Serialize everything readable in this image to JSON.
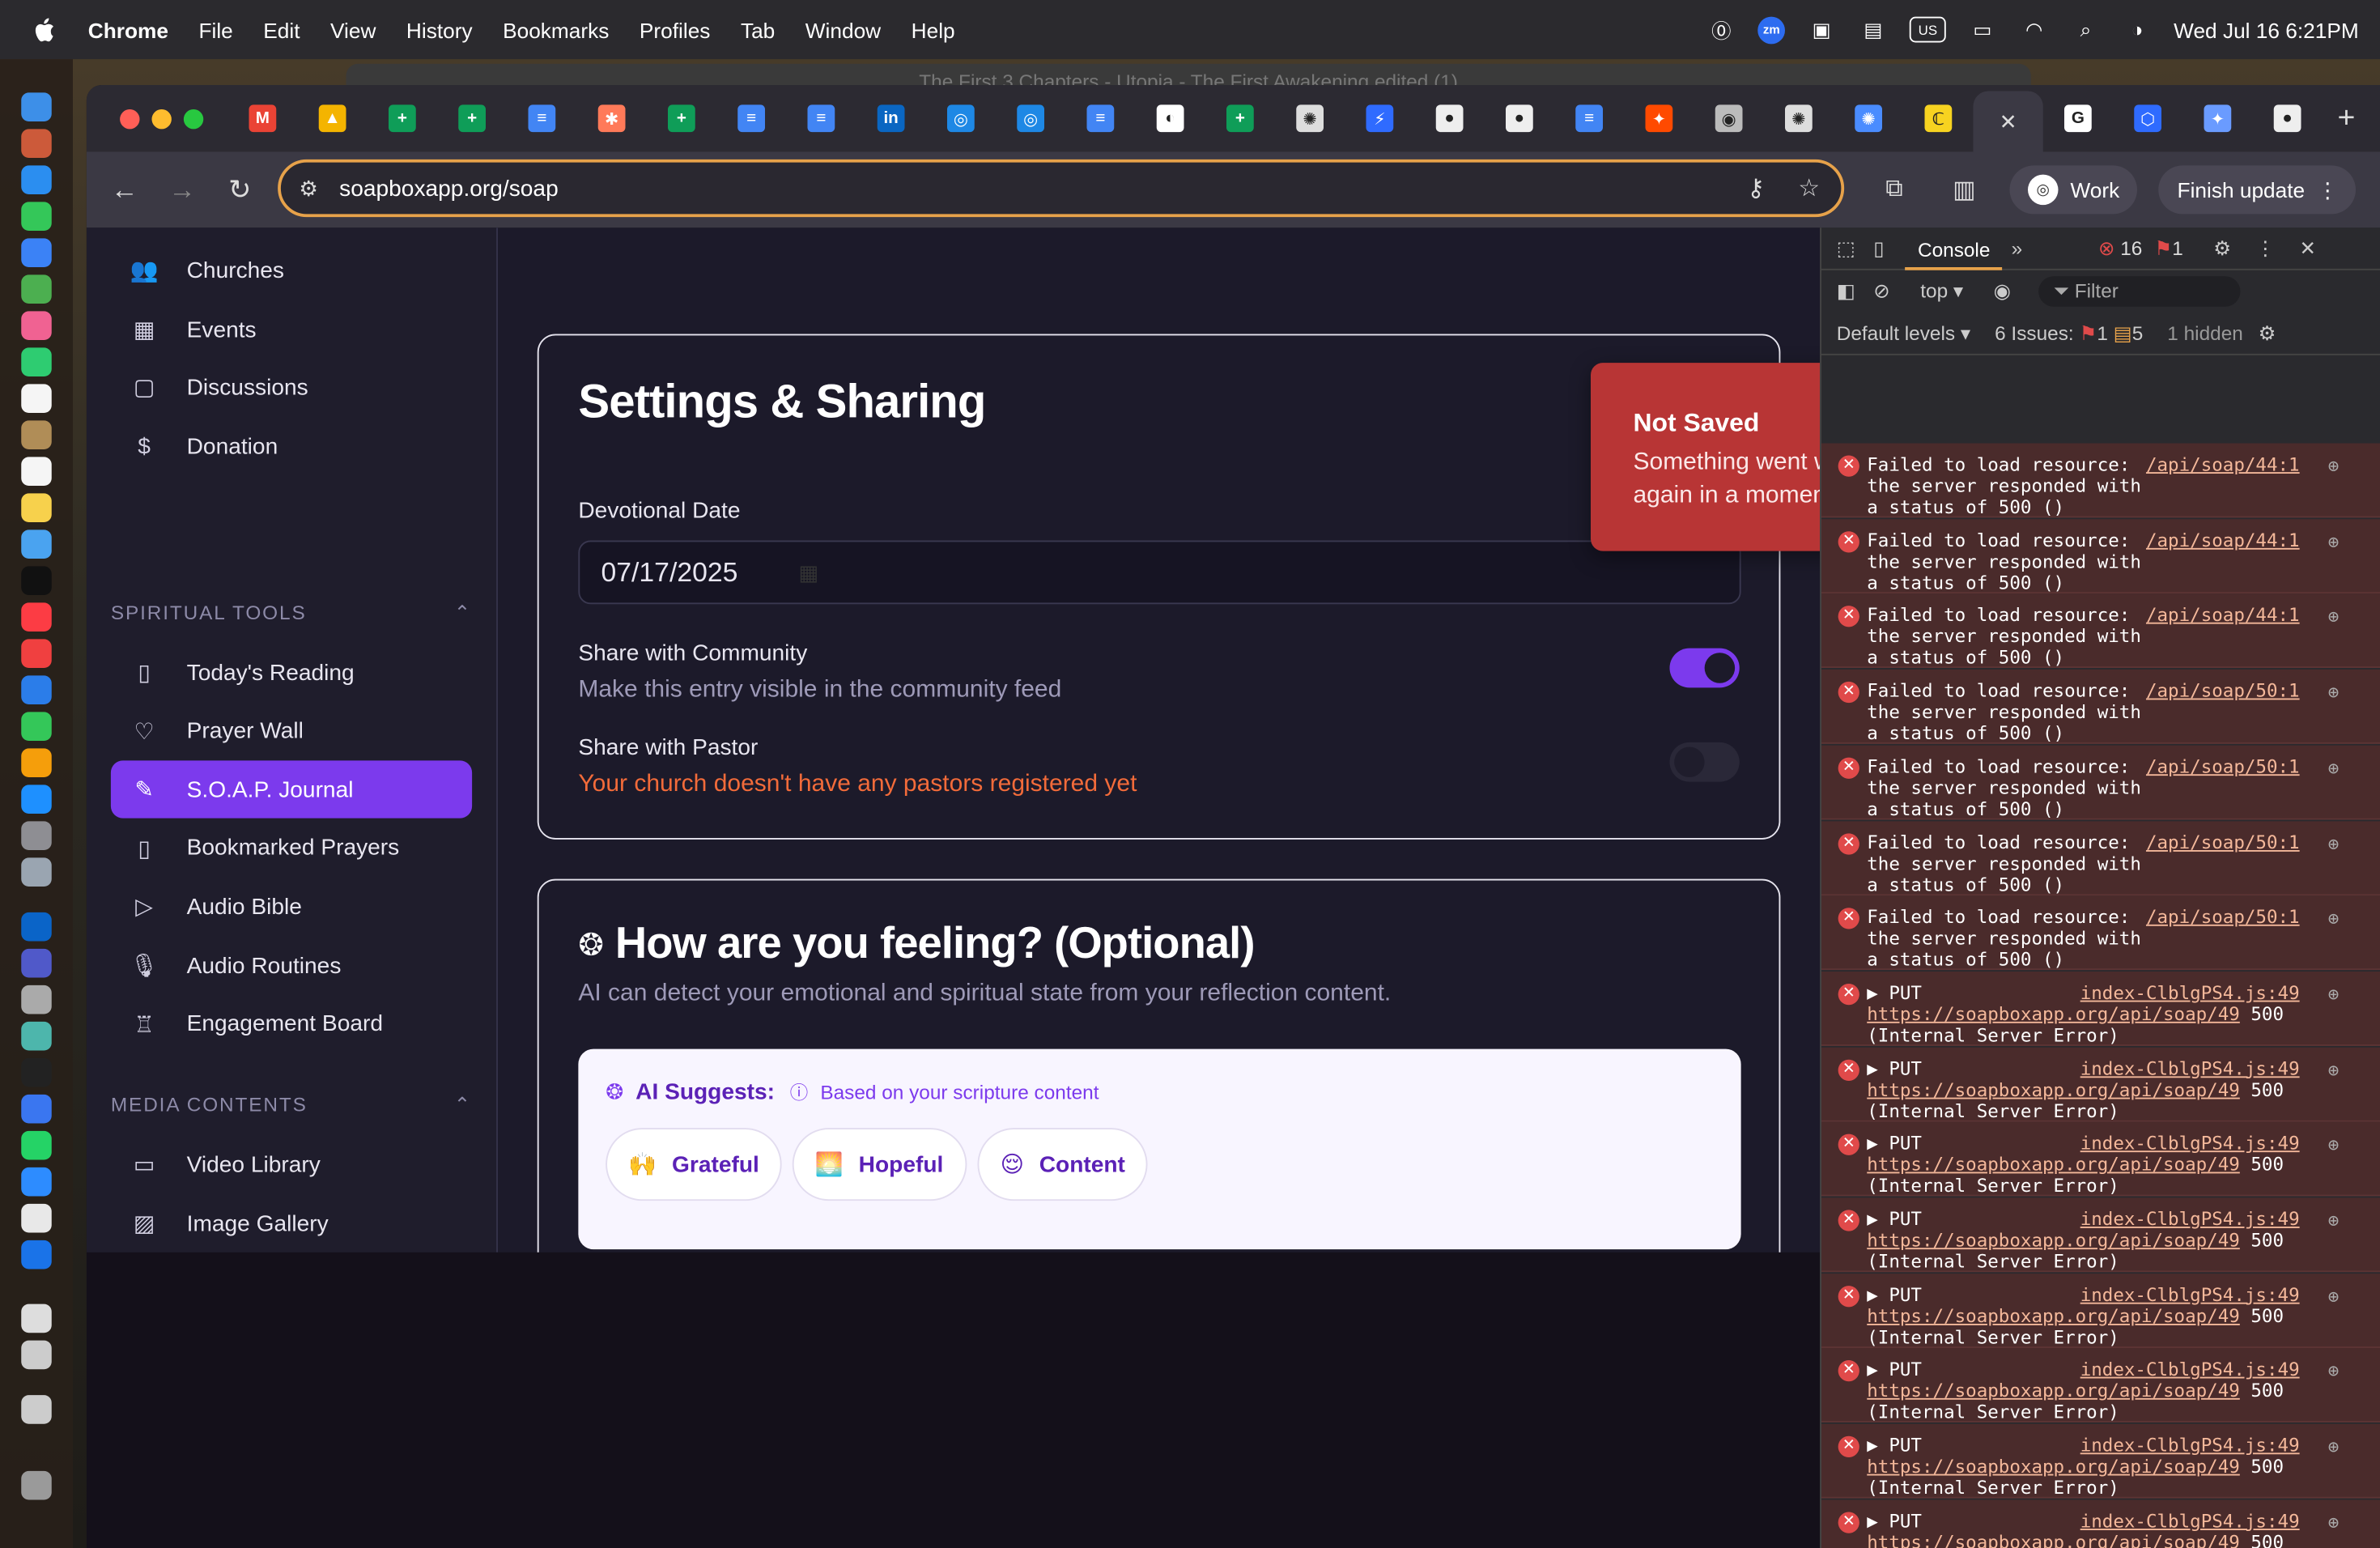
{
  "menubar": {
    "app": "Chrome",
    "items": [
      "File",
      "Edit",
      "View",
      "History",
      "Bookmarks",
      "Profiles",
      "Tab",
      "Window",
      "Help"
    ],
    "clock": "Wed Jul 16  6:21PM",
    "zoom_badge": "zm",
    "kbd": "US"
  },
  "desktop": {
    "ghost_title": "The First 3 Chapters - Utopia - The First Awakening edited (1)"
  },
  "browser": {
    "url": "soapboxapp.org/soap",
    "profile": "Work",
    "update": "Finish update",
    "tabs": [
      {
        "icon": "gmail-icon",
        "color": "#ea4335",
        "glyph": "M"
      },
      {
        "icon": "drive-icon",
        "color": "#f4b400",
        "glyph": "▲"
      },
      {
        "icon": "sheets-icon",
        "color": "#0f9d58",
        "glyph": "+"
      },
      {
        "icon": "sheets-icon",
        "color": "#0f9d58",
        "glyph": "+"
      },
      {
        "icon": "docs-icon",
        "color": "#4285f4",
        "glyph": "≡"
      },
      {
        "icon": "hubspot-icon",
        "color": "#ff7a59",
        "glyph": "✱"
      },
      {
        "icon": "sheets-icon",
        "color": "#0f9d58",
        "glyph": "+"
      },
      {
        "icon": "docs-icon",
        "color": "#4285f4",
        "glyph": "≡"
      },
      {
        "icon": "docs-icon",
        "color": "#4285f4",
        "glyph": "≡"
      },
      {
        "icon": "linkedin-icon",
        "color": "#0a66c2",
        "glyph": "in"
      },
      {
        "icon": "safari-icon",
        "color": "#1e88e5",
        "glyph": "◎"
      },
      {
        "icon": "safari-icon",
        "color": "#1e88e5",
        "glyph": "◎"
      },
      {
        "icon": "docs-icon",
        "color": "#4285f4",
        "glyph": "≡"
      },
      {
        "icon": "notion-icon",
        "color": "#ffffff",
        "glyph": "◐"
      },
      {
        "icon": "sheets-icon",
        "color": "#0f9d58",
        "glyph": "+"
      },
      {
        "icon": "openai-icon",
        "color": "#dddddd",
        "glyph": "✺"
      },
      {
        "icon": "bolt-icon",
        "color": "#2f6bff",
        "glyph": "⚡"
      },
      {
        "icon": "github-icon",
        "color": "#eeeeee",
        "glyph": "●"
      },
      {
        "icon": "github-icon",
        "color": "#eeeeee",
        "glyph": "●"
      },
      {
        "icon": "docs-icon",
        "color": "#4285f4",
        "glyph": "≡"
      },
      {
        "icon": "zapier-icon",
        "color": "#ff4a00",
        "glyph": "✦"
      },
      {
        "icon": "globe-icon",
        "color": "#bbbbbb",
        "glyph": "◉"
      },
      {
        "icon": "openai-icon",
        "color": "#dddddd",
        "glyph": "✺"
      },
      {
        "icon": "openai-blue-icon",
        "color": "#4a8cff",
        "glyph": "✺"
      },
      {
        "icon": "app-icon",
        "color": "#f7d320",
        "glyph": "ℂ"
      },
      {
        "icon": "close-icon",
        "color": "#dddddd",
        "glyph": "✕"
      },
      {
        "icon": "google-icon",
        "color": "#ffffff",
        "glyph": "G"
      },
      {
        "icon": "hex-icon",
        "color": "#2f6bff",
        "glyph": "⬡"
      },
      {
        "icon": "gemini-icon",
        "color": "#6a9bff",
        "glyph": "✦"
      },
      {
        "icon": "github-icon",
        "color": "#eeeeee",
        "glyph": "●"
      }
    ],
    "new_tab": "+"
  },
  "sidebar": {
    "top_items": [
      {
        "label": "Churches",
        "icon": "users-icon"
      },
      {
        "label": "Events",
        "icon": "calendar-icon"
      },
      {
        "label": "Discussions",
        "icon": "chat-icon"
      },
      {
        "label": "Donation",
        "icon": "dollar-icon"
      }
    ],
    "section1": "SPIRITUAL TOOLS",
    "tools": [
      {
        "label": "Today's Reading",
        "icon": "book-icon"
      },
      {
        "label": "Prayer Wall",
        "icon": "heart-icon"
      },
      {
        "label": "S.O.A.P. Journal",
        "icon": "pen-icon",
        "active": true
      },
      {
        "label": "Bookmarked Prayers",
        "icon": "bookmark-icon"
      },
      {
        "label": "Audio Bible",
        "icon": "play-icon"
      },
      {
        "label": "Audio Routines",
        "icon": "mic-icon"
      },
      {
        "label": "Engagement Board",
        "icon": "trophy-icon"
      }
    ],
    "section2": "MEDIA CONTENTS",
    "media": [
      {
        "label": "Video Library",
        "icon": "video-icon"
      },
      {
        "label": "Image Gallery",
        "icon": "image-icon"
      }
    ]
  },
  "settings": {
    "title": "Settings & Sharing",
    "date_label": "Devotional Date",
    "date_value": "07/17/2025",
    "community_label": "Share with Community",
    "community_desc": "Make this entry visible in the community feed",
    "community_on": true,
    "pastor_label": "Share with Pastor",
    "pastor_desc": "Your church doesn't have any pastors registered yet",
    "pastor_on": false
  },
  "toast": {
    "title": "Not Saved",
    "message": "Something went wrong on our end. Please try again in a moment."
  },
  "feeling": {
    "title": "How are you feeling? (Optional)",
    "subtitle": "AI can detect your emotional and spiritual state from your reflection content.",
    "suggest_label": "AI Suggests:",
    "suggest_note": "Based on your scripture content",
    "chips": [
      {
        "emoji": "🙌",
        "label": "Grateful"
      },
      {
        "emoji": "🌅",
        "label": "Hopeful"
      },
      {
        "emoji": "😌",
        "label": "Content"
      }
    ]
  },
  "devtools": {
    "tab": "Console",
    "errors": "16",
    "issues_badge": "1",
    "context": "top",
    "filter": "Filter",
    "levels": "Default levels",
    "issues": "6 Issues:",
    "issue_err": "1",
    "issue_warn": "5",
    "hidden": "1 hidden",
    "logs": [
      {
        "kind": "load",
        "text": "Failed to load resource:\nthe server responded with\na status of 500 ()",
        "link": "/api/soap/44:1"
      },
      {
        "kind": "load",
        "text": "Failed to load resource:\nthe server responded with\na status of 500 ()",
        "link": "/api/soap/44:1"
      },
      {
        "kind": "load",
        "text": "Failed to load resource:\nthe server responded with\na status of 500 ()",
        "link": "/api/soap/44:1"
      },
      {
        "kind": "load",
        "text": "Failed to load resource:\nthe server responded with\na status of 500 ()",
        "link": "/api/soap/50:1"
      },
      {
        "kind": "load",
        "text": "Failed to load resource:\nthe server responded with\na status of 500 ()",
        "link": "/api/soap/50:1"
      },
      {
        "kind": "load",
        "text": "Failed to load resource:\nthe server responded with\na status of 500 ()",
        "link": "/api/soap/50:1"
      },
      {
        "kind": "load",
        "text": "Failed to load resource:\nthe server responded with\na status of 500 ()",
        "link": "/api/soap/50:1"
      },
      {
        "kind": "put",
        "method": "▶ PUT",
        "src": "index-ClblgPS4.js:49",
        "url": "https://soapboxapp.org/api/soap/49",
        "code": "500",
        "status": "(Internal Server Error)"
      },
      {
        "kind": "put",
        "method": "▶ PUT",
        "src": "index-ClblgPS4.js:49",
        "url": "https://soapboxapp.org/api/soap/49",
        "code": "500",
        "status": "(Internal Server Error)"
      },
      {
        "kind": "put",
        "method": "▶ PUT",
        "src": "index-ClblgPS4.js:49",
        "url": "https://soapboxapp.org/api/soap/49",
        "code": "500",
        "status": "(Internal Server Error)"
      },
      {
        "kind": "put",
        "method": "▶ PUT",
        "src": "index-ClblgPS4.js:49",
        "url": "https://soapboxapp.org/api/soap/49",
        "code": "500",
        "status": "(Internal Server Error)"
      },
      {
        "kind": "put",
        "method": "▶ PUT",
        "src": "index-ClblgPS4.js:49",
        "url": "https://soapboxapp.org/api/soap/49",
        "code": "500",
        "status": "(Internal Server Error)"
      },
      {
        "kind": "put",
        "method": "▶ PUT",
        "src": "index-ClblgPS4.js:49",
        "url": "https://soapboxapp.org/api/soap/49",
        "code": "500",
        "status": "(Internal Server Error)"
      },
      {
        "kind": "put",
        "method": "▶ PUT",
        "src": "index-ClblgPS4.js:49",
        "url": "https://soapboxapp.org/api/soap/49",
        "code": "500",
        "status": "(Internal Server Error)"
      },
      {
        "kind": "put",
        "method": "▶ PUT",
        "src": "index-ClblgPS4.js:49",
        "url": "https://soapboxapp.org/api/soap/49",
        "code": "500",
        "status": "(Internal Server Error)"
      }
    ],
    "prompt": "›"
  },
  "colors": {
    "accent": "#7c3aed",
    "toast": "#b83535",
    "warning": "#f26b3a",
    "omnibox_border": "#e7a24a"
  }
}
